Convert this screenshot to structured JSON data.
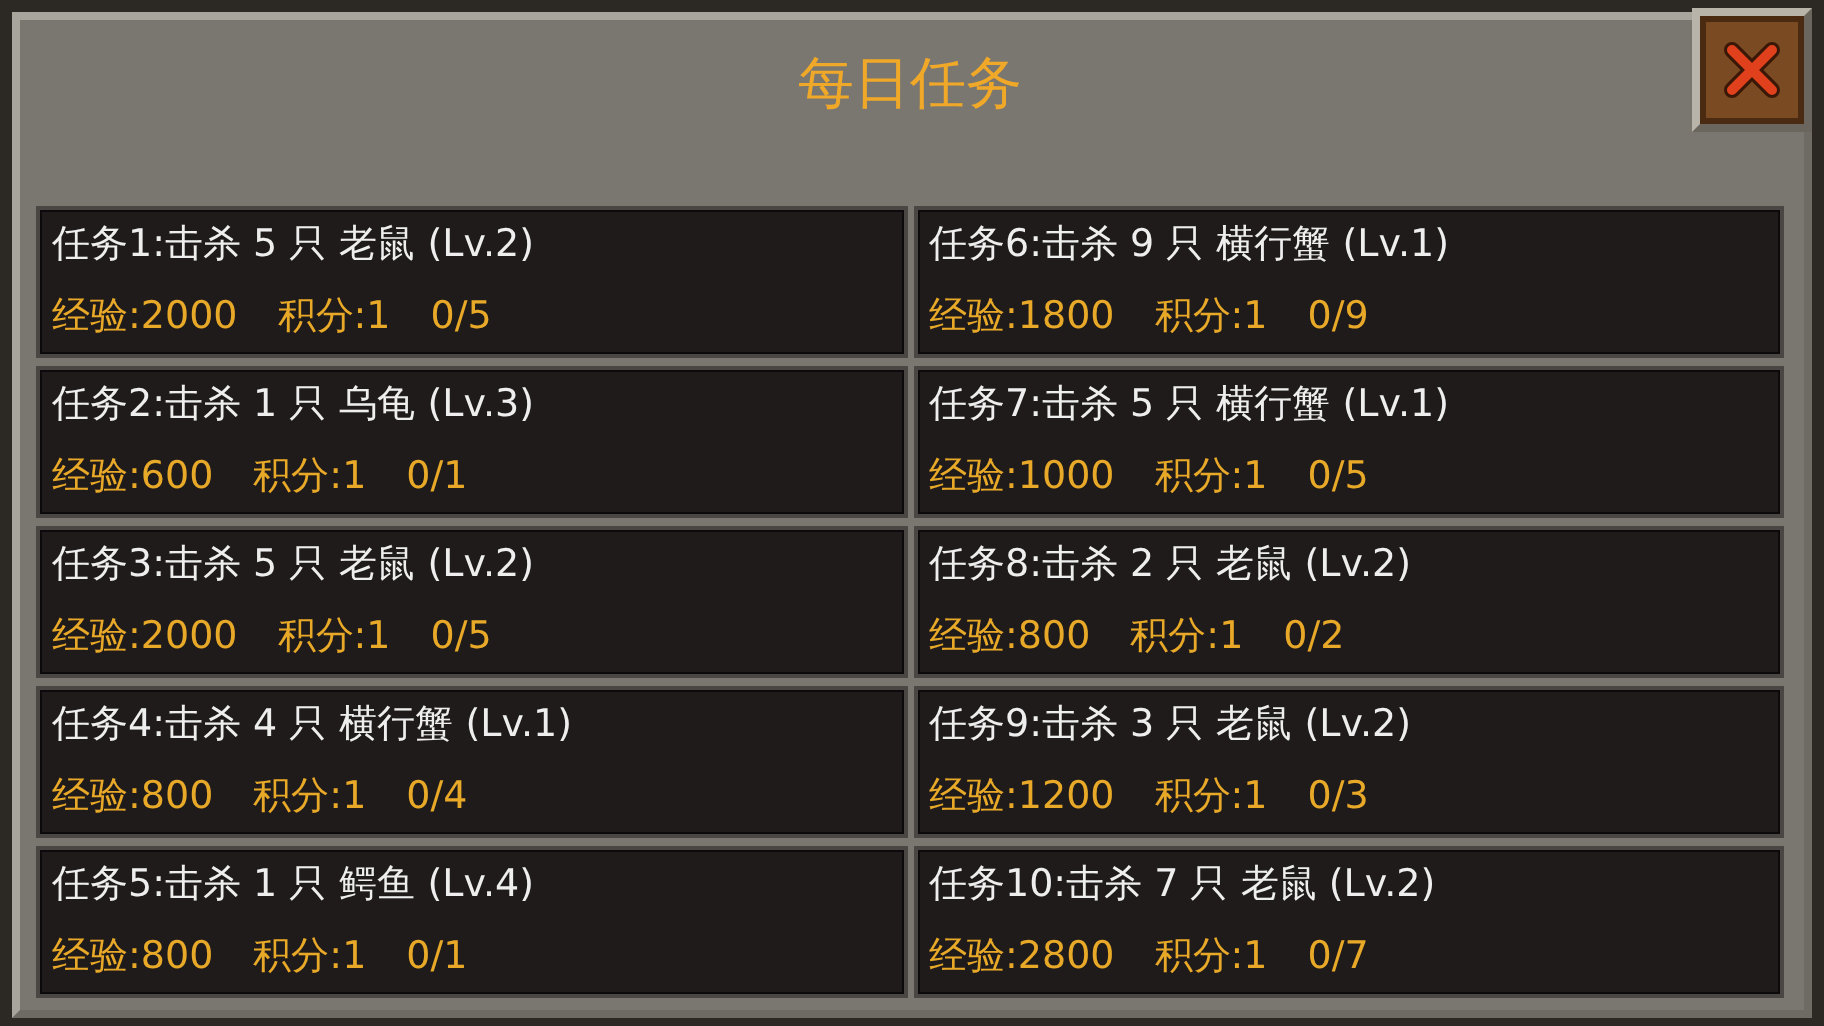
{
  "window": {
    "title": "每日任务"
  },
  "tasks": [
    {
      "title": "任务1:击杀 5 只 老鼠 (Lv.2)",
      "exp": "经验:2000",
      "points": "积分:1",
      "progress": "0/5"
    },
    {
      "title": "任务6:击杀 9 只 横行蟹 (Lv.1)",
      "exp": "经验:1800",
      "points": "积分:1",
      "progress": "0/9"
    },
    {
      "title": "任务2:击杀 1 只 乌龟 (Lv.3)",
      "exp": "经验:600",
      "points": "积分:1",
      "progress": "0/1"
    },
    {
      "title": "任务7:击杀 5 只 横行蟹 (Lv.1)",
      "exp": "经验:1000",
      "points": "积分:1",
      "progress": "0/5"
    },
    {
      "title": "任务3:击杀 5 只 老鼠 (Lv.2)",
      "exp": "经验:2000",
      "points": "积分:1",
      "progress": "0/5"
    },
    {
      "title": "任务8:击杀 2 只 老鼠 (Lv.2)",
      "exp": "经验:800",
      "points": "积分:1",
      "progress": "0/2"
    },
    {
      "title": "任务4:击杀 4 只 横行蟹 (Lv.1)",
      "exp": "经验:800",
      "points": "积分:1",
      "progress": "0/4"
    },
    {
      "title": "任务9:击杀 3 只 老鼠 (Lv.2)",
      "exp": "经验:1200",
      "points": "积分:1",
      "progress": "0/3"
    },
    {
      "title": "任务5:击杀 1 只 鳄鱼 (Lv.4)",
      "exp": "经验:800",
      "points": "积分:1",
      "progress": "0/1"
    },
    {
      "title": "任务10:击杀 7 只 老鼠 (Lv.2)",
      "exp": "经验:2800",
      "points": "积分:1",
      "progress": "0/7"
    }
  ]
}
